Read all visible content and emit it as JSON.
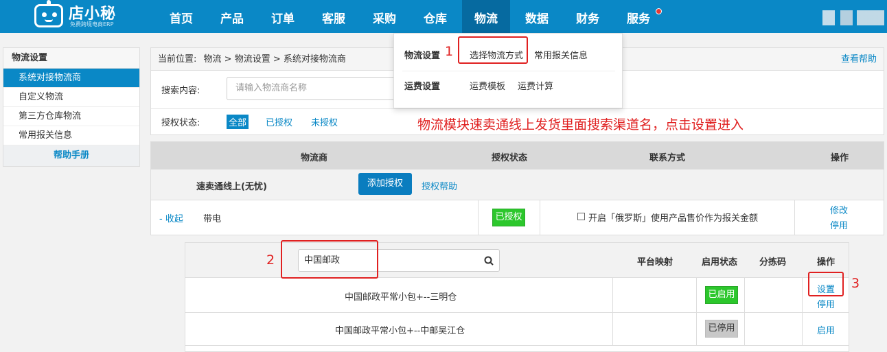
{
  "header": {
    "logo_text": "店小秘",
    "logo_sub": "免费跨境电商ERP",
    "nav": [
      "首页",
      "产品",
      "订单",
      "客服",
      "采购",
      "仓库",
      "物流",
      "数据",
      "财务",
      "服务"
    ],
    "active_nav": "物流",
    "colors": {
      "topbar": "#0a88c6",
      "active_nav": "#066aa0",
      "notification_dot": "#e53935"
    }
  },
  "dropdown": {
    "row1_title": "物流设置",
    "row1_links": [
      "选择物流方式",
      "常用报关信息"
    ],
    "row2_title": "运费设置",
    "row2_links": [
      "运费模板",
      "运费计算"
    ]
  },
  "sidebar": {
    "title": "物流设置",
    "items": [
      "系统对接物流商",
      "自定义物流",
      "第三方仓库物流",
      "常用报关信息"
    ],
    "active_item": "系统对接物流商",
    "help": "帮助手册"
  },
  "breadcrumb": {
    "prefix": "当前位置:",
    "path": "物流 > 物流设置 > 系统对接物流商",
    "help": "查看帮助"
  },
  "search": {
    "label": "搜索内容:",
    "placeholder": "请输入物流商名称"
  },
  "auth_filter": {
    "label": "授权状态:",
    "options": [
      "全部",
      "已授权",
      "未授权"
    ],
    "selected": "全部"
  },
  "annotations": {
    "text": "物流模块速卖通线上发货里面搜索渠道名，点击设置进入",
    "step1": "1",
    "step2": "2",
    "step3": "3",
    "color": "#e02020"
  },
  "logistics_table": {
    "headers": [
      "物流商",
      "授权状态",
      "联系方式",
      "操作"
    ],
    "provider": {
      "name": "速卖通线上(无忧)",
      "add_auth": "添加授权",
      "auth_help": "授权帮助"
    },
    "row": {
      "collapse": "- 收起",
      "name": "带电",
      "status": "已授权",
      "option": "开启「俄罗斯」使用产品售价作为报关金额",
      "actions": [
        "修改",
        "停用"
      ]
    }
  },
  "channel_table": {
    "search_value": "中国邮政",
    "headers": [
      "平台映射",
      "启用状态",
      "分拣码",
      "操作"
    ],
    "rows": [
      {
        "name": "中国邮政平常小包+--三明仓",
        "status": "已启用",
        "actions": [
          "设置",
          "停用"
        ]
      },
      {
        "name": "中国邮政平常小包+--中邮吴江仓",
        "status": "已停用",
        "actions": [
          "启用"
        ]
      }
    ]
  }
}
